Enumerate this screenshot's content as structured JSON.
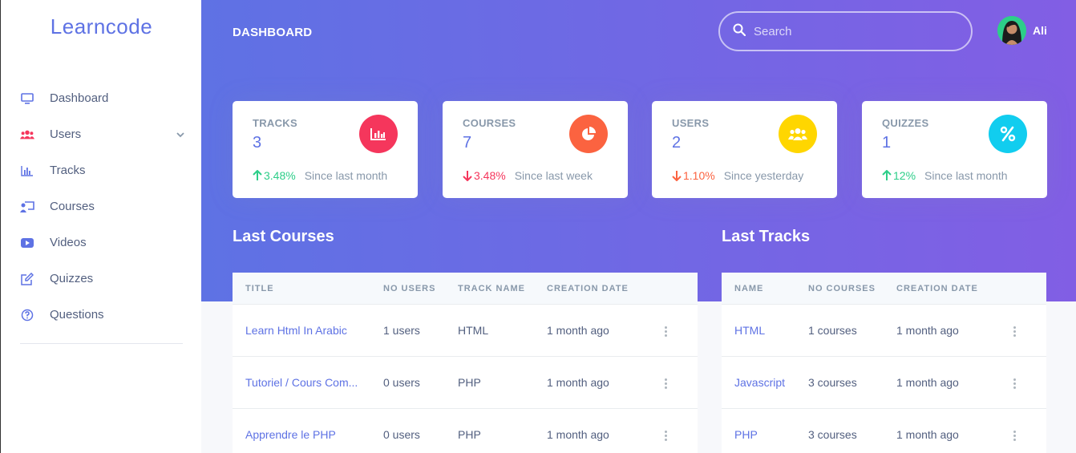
{
  "brand": "Learncode",
  "sidebar": {
    "items": [
      {
        "label": "Dashboard",
        "icon": "monitor-icon"
      },
      {
        "label": "Users",
        "icon": "users-icon"
      },
      {
        "label": "Tracks",
        "icon": "bar-chart-icon"
      },
      {
        "label": "Courses",
        "icon": "chalkboard-icon"
      },
      {
        "label": "Videos",
        "icon": "youtube-icon"
      },
      {
        "label": "Quizzes",
        "icon": "edit-icon"
      },
      {
        "label": "Questions",
        "icon": "question-circle-icon"
      }
    ]
  },
  "header": {
    "title": "DASHBOARD",
    "search_placeholder": "Search",
    "user_name": "Ali"
  },
  "stats": [
    {
      "title": "TRACKS",
      "value": "3",
      "change": "3.48%",
      "direction": "up",
      "since": "Since last month",
      "icon": "chart-bar-icon",
      "icon_color": "#f5365c",
      "change_color": "#2dce89"
    },
    {
      "title": "COURSES",
      "value": "7",
      "change": "3.48%",
      "direction": "down",
      "since": "Since last week",
      "icon": "chart-pie-icon",
      "icon_color": "#fb6340",
      "change_color": "#f5365c"
    },
    {
      "title": "USERS",
      "value": "2",
      "change": "1.10%",
      "direction": "down",
      "since": "Since yesterday",
      "icon": "users-icon",
      "icon_color": "#ffd600",
      "change_color": "#fb6340"
    },
    {
      "title": "QUIZZES",
      "value": "1",
      "change": "12%",
      "direction": "up",
      "since": "Since last month",
      "icon": "percent-icon",
      "icon_color": "#11cdef",
      "change_color": "#2dce89"
    }
  ],
  "last_courses": {
    "title": "Last Courses",
    "columns": [
      "TITLE",
      "NO USERS",
      "TRACK NAME",
      "CREATION DATE"
    ],
    "rows": [
      {
        "title": "Learn Html In Arabic",
        "users": "1 users",
        "track": "HTML",
        "date": "1 month ago"
      },
      {
        "title": "Tutoriel / Cours Com...",
        "users": "0 users",
        "track": "PHP",
        "date": "1 month ago"
      },
      {
        "title": "Apprendre le PHP",
        "users": "0 users",
        "track": "PHP",
        "date": "1 month ago"
      }
    ]
  },
  "last_tracks": {
    "title": "Last Tracks",
    "columns": [
      "NAME",
      "NO COURSES",
      "CREATION DATE"
    ],
    "rows": [
      {
        "name": "HTML",
        "courses": "1 courses",
        "date": "1 month ago"
      },
      {
        "name": "Javascript",
        "courses": "3 courses",
        "date": "1 month ago"
      },
      {
        "name": "PHP",
        "courses": "3 courses",
        "date": "1 month ago"
      }
    ]
  },
  "colors": {
    "primary": "#5e72e4",
    "gradient_end": "#825ee4"
  }
}
